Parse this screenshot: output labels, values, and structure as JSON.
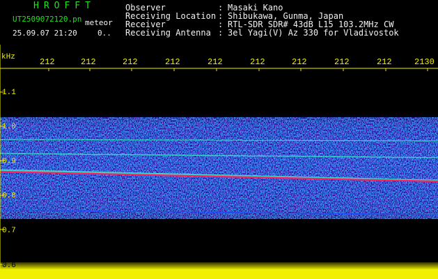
{
  "header": {
    "title": "HROFFT",
    "filename": "UT2509072120.pn",
    "tag": "meteor",
    "datetime": "25.09.07 21:20",
    "count": "0.."
  },
  "info": [
    {
      "label": "Observer",
      "sep": ":",
      "value": "Masaki Kano"
    },
    {
      "label": "Receiving Location",
      "sep": ":",
      "value": "Shibukawa, Gunma, Japan"
    },
    {
      "label": "Receiver",
      "sep": ":",
      "value": "RTL-SDR SDR# 43dB L15 103.2MHz CW"
    },
    {
      "label": "Receiving Antenna",
      "sep": ":",
      "value": "3el Yagi(V) Az 330 for Vladivostok"
    }
  ],
  "axes": {
    "y_unit": "kHz",
    "y_ticks": [
      "1.1",
      "1.0",
      "0.9",
      "0.8",
      "0.7",
      "0.6"
    ],
    "x_ticks": [
      "212",
      "212",
      "212",
      "212",
      "212",
      "212",
      "212",
      "212",
      "212",
      "2130"
    ]
  },
  "colors": {
    "header_title": "#1de21d",
    "header_text": "#f2f2f2",
    "tick_labels": "#f0f000",
    "noise_band": "#1a3cff",
    "signal_cyan": "#3cf0c8",
    "signal_red": "#ff2060",
    "bottom_band": "#f0f000"
  }
}
